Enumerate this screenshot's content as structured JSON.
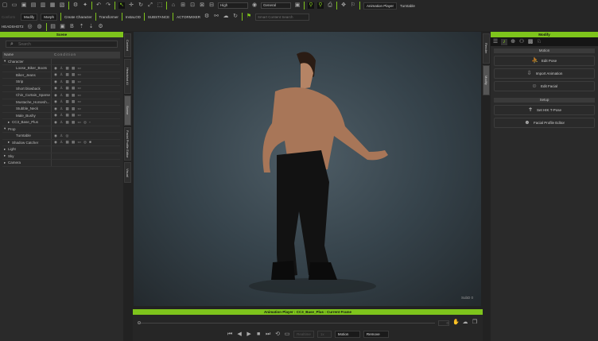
{
  "toolbar": {
    "quality": "High",
    "view_mode": "General",
    "modify": "Modify",
    "morph": "Morph",
    "create_character": "Create Character",
    "transformer": "Transformer",
    "installdd": "InstaLOD",
    "substance": "SUBSTANCE",
    "actormixer": "ACTORMIXER",
    "content_search_placeholder": "Smart Content Search",
    "animation_player": "Animation Player",
    "turntable": "Turntable",
    "headshot": "HEADSHOT2"
  },
  "scene": {
    "title": "Scene",
    "search_placeholder": "Search",
    "col_name": "Name",
    "col_condition": "Condition",
    "items": [
      {
        "label": "Character",
        "level": 0,
        "arrow": "▾",
        "cond": ""
      },
      {
        "label": "Loose_Biker_Boots",
        "level": 2,
        "arrow": "",
        "cond": "◉ ♙ ▦ ▦ ▭"
      },
      {
        "label": "Biker_Jeans",
        "level": 2,
        "arrow": "",
        "cond": "◉ ♙ ▦ ▦ ▭"
      },
      {
        "label": "Strip",
        "level": 2,
        "arrow": "",
        "cond": "◉ ♙ ▦ ▦ ▭"
      },
      {
        "label": "Short blowback",
        "level": 2,
        "arrow": "",
        "cond": "◉ ♙ ▦ ▦ ▭"
      },
      {
        "label": "Chin_Curtain_Sparse",
        "level": 2,
        "arrow": "",
        "cond": "◉ ♙ ▦ ▦ ▭"
      },
      {
        "label": "Mustache_Horsesh...",
        "level": 2,
        "arrow": "",
        "cond": "◉ ♙ ▦ ▦ ▭"
      },
      {
        "label": "Stubble_Neck",
        "level": 2,
        "arrow": "",
        "cond": "◉ ♙ ▦ ▦ ▭"
      },
      {
        "label": "Male_Bushy",
        "level": 2,
        "arrow": "",
        "cond": "◉ ♙ ▦ ▦ ▭"
      },
      {
        "label": "CC3_Base_Plus",
        "level": 1,
        "arrow": "▸",
        "cond": "◉ ♙ ▦ ▦ ▭ ◎ ▫"
      },
      {
        "label": "Prop",
        "level": 0,
        "arrow": "▾",
        "cond": ""
      },
      {
        "label": "Turntable",
        "level": 2,
        "arrow": "",
        "cond": "◉ ♙ ◎"
      },
      {
        "label": "Shadow Catcher",
        "level": 1,
        "arrow": "▸",
        "cond": "◉ ♙ ▦ ▦ ▭ ◎ ■"
      },
      {
        "label": "Light",
        "level": 0,
        "arrow": "▸",
        "cond": ""
      },
      {
        "label": "Sky",
        "level": 0,
        "arrow": "▸",
        "cond": ""
      },
      {
        "label": "Camera",
        "level": 0,
        "arrow": "▸",
        "cond": ""
      }
    ]
  },
  "left_tabs": [
    "Content",
    "Headshot AI",
    "Scene",
    "Facial Profile Editor",
    "Visual"
  ],
  "right_tabs": [
    "Render",
    "Modify"
  ],
  "viewport": {
    "subd": "SubD 0"
  },
  "player": {
    "title": "Animation Player : CC3_Base_Plus : Current Frame",
    "frame": "0",
    "realtime": "Realtime",
    "speed": "1x",
    "motion": "Motion",
    "remove": "Remove"
  },
  "modify": {
    "title": "Modify",
    "motion_section": "Motion",
    "edit_pose": "Edit Pose",
    "import_animation": "Import Animation",
    "edit_facial": "Edit Facial",
    "setup_section": "Setup",
    "set_t_pose": "Set HIK T-Pose",
    "facial_profile_editor": "Facial Profile Editor"
  }
}
